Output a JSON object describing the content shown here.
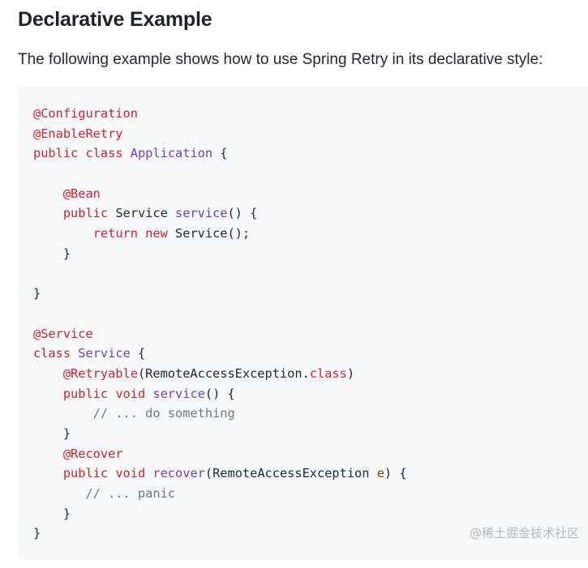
{
  "heading": "Declarative Example",
  "intro": "The following example shows how to use Spring Retry in its declarative style:",
  "watermark": "@稀土掘金技术社区",
  "colors": {
    "code_background": "#f6f8fa",
    "keyword": "#cf222e",
    "annotation": "#cf222e",
    "type_name": "#6f42c1",
    "comment": "#6e7781",
    "parameter": "#953800"
  },
  "code_lines": [
    [
      {
        "t": "@Configuration",
        "k": "ann"
      }
    ],
    [
      {
        "t": "@EnableRetry",
        "k": "ann"
      }
    ],
    [
      {
        "t": "public",
        "k": "kw"
      },
      {
        "t": " ",
        "k": "plain"
      },
      {
        "t": "class",
        "k": "kw"
      },
      {
        "t": " ",
        "k": "plain"
      },
      {
        "t": "Application",
        "k": "type"
      },
      {
        "t": " {",
        "k": "plain"
      }
    ],
    [],
    [
      {
        "t": "    ",
        "k": "plain"
      },
      {
        "t": "@Bean",
        "k": "ann"
      }
    ],
    [
      {
        "t": "    ",
        "k": "plain"
      },
      {
        "t": "public",
        "k": "kw"
      },
      {
        "t": " Service ",
        "k": "plain"
      },
      {
        "t": "service",
        "k": "fn"
      },
      {
        "t": "() {",
        "k": "plain"
      }
    ],
    [
      {
        "t": "        ",
        "k": "plain"
      },
      {
        "t": "return",
        "k": "kw"
      },
      {
        "t": " ",
        "k": "plain"
      },
      {
        "t": "new",
        "k": "kw"
      },
      {
        "t": " Service();",
        "k": "plain"
      }
    ],
    [
      {
        "t": "    }",
        "k": "plain"
      }
    ],
    [],
    [
      {
        "t": "}",
        "k": "plain"
      }
    ],
    [],
    [
      {
        "t": "@Service",
        "k": "ann"
      }
    ],
    [
      {
        "t": "class",
        "k": "kw"
      },
      {
        "t": " ",
        "k": "plain"
      },
      {
        "t": "Service",
        "k": "type"
      },
      {
        "t": " {",
        "k": "plain"
      }
    ],
    [
      {
        "t": "    ",
        "k": "plain"
      },
      {
        "t": "@Retryable",
        "k": "ann"
      },
      {
        "t": "(RemoteAccessException.",
        "k": "plain"
      },
      {
        "t": "class",
        "k": "kw"
      },
      {
        "t": ")",
        "k": "plain"
      }
    ],
    [
      {
        "t": "    ",
        "k": "plain"
      },
      {
        "t": "public",
        "k": "kw"
      },
      {
        "t": " ",
        "k": "plain"
      },
      {
        "t": "void",
        "k": "kw"
      },
      {
        "t": " ",
        "k": "plain"
      },
      {
        "t": "service",
        "k": "fn"
      },
      {
        "t": "() {",
        "k": "plain"
      }
    ],
    [
      {
        "t": "        ",
        "k": "plain"
      },
      {
        "t": "// ... do something",
        "k": "com"
      }
    ],
    [
      {
        "t": "    }",
        "k": "plain"
      }
    ],
    [
      {
        "t": "    ",
        "k": "plain"
      },
      {
        "t": "@Recover",
        "k": "ann"
      }
    ],
    [
      {
        "t": "    ",
        "k": "plain"
      },
      {
        "t": "public",
        "k": "kw"
      },
      {
        "t": " ",
        "k": "plain"
      },
      {
        "t": "void",
        "k": "kw"
      },
      {
        "t": " ",
        "k": "plain"
      },
      {
        "t": "recover",
        "k": "fn"
      },
      {
        "t": "(RemoteAccessException ",
        "k": "plain"
      },
      {
        "t": "e",
        "k": "param"
      },
      {
        "t": ") {",
        "k": "plain"
      }
    ],
    [
      {
        "t": "       ",
        "k": "plain"
      },
      {
        "t": "// ... panic",
        "k": "com"
      }
    ],
    [
      {
        "t": "    }",
        "k": "plain"
      }
    ],
    [
      {
        "t": "}",
        "k": "plain"
      }
    ]
  ]
}
